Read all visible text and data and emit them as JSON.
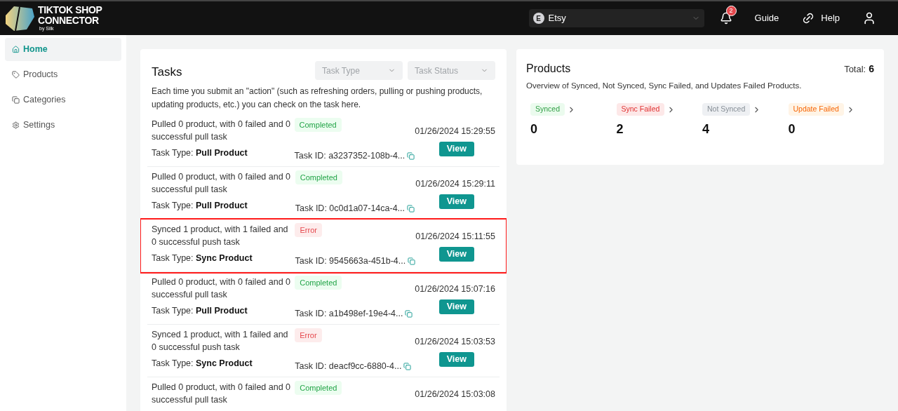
{
  "logo": {
    "line1": "TIKTOK SHOP",
    "line2": "CONNECTOR",
    "byline": "by Silk"
  },
  "header": {
    "store": {
      "initial": "E",
      "name": "Etsy"
    },
    "notifications": "2",
    "guide": "Guide",
    "help": "Help"
  },
  "sidebar": {
    "items": [
      {
        "label": "Home",
        "selected": true
      },
      {
        "label": "Products",
        "selected": false
      },
      {
        "label": "Categories",
        "selected": false
      },
      {
        "label": "Settings",
        "selected": false
      }
    ]
  },
  "tasks": {
    "title": "Tasks",
    "filters": [
      {
        "placeholder": "Task Type"
      },
      {
        "placeholder": "Task Status"
      }
    ],
    "description": "Each time you submit an \"action\" (such as refreshing orders, pulling or pushing products, updating products, etc.) you can check on the task here.",
    "rows": [
      {
        "summary": "Pulled 0 product, with 0 failed and 0 successful pull task",
        "status": "Completed",
        "kind": "completed",
        "type_label": "Task Type:",
        "type": "Pull Product",
        "task_id": "Task ID: a3237352-108b-4...",
        "date": "01/26/2024 15:29:55",
        "view": "View",
        "highlighted": false
      },
      {
        "summary": "Pulled 0 product, with 0 failed and 0 successful pull task",
        "status": "Completed",
        "kind": "completed",
        "type_label": "Task Type:",
        "type": "Pull Product",
        "task_id": "Task ID: 0c0d1a07-14ca-4...",
        "date": "01/26/2024 15:29:11",
        "view": "View",
        "highlighted": false
      },
      {
        "summary": "Synced 1 product, with 1 failed and 0 successful push task",
        "status": "Error",
        "kind": "error",
        "type_label": "Task Type:",
        "type": "Sync Product",
        "task_id": "Task ID: 9545663a-451b-4...",
        "date": "01/26/2024 15:11:55",
        "view": "View",
        "highlighted": true
      },
      {
        "summary": "Pulled 0 product, with 0 failed and 0 successful pull task",
        "status": "Completed",
        "kind": "completed",
        "type_label": "Task Type:",
        "type": "Pull Product",
        "task_id": "Task ID: a1b498ef-19e4-4...",
        "date": "01/26/2024 15:07:16",
        "view": "View",
        "highlighted": false
      },
      {
        "summary": "Synced 1 product, with 1 failed and 0 successful push task",
        "status": "Error",
        "kind": "error",
        "type_label": "Task Type:",
        "type": "Sync Product",
        "task_id": "Task ID: deacf9cc-6880-4...",
        "date": "01/26/2024 15:03:53",
        "view": "View",
        "highlighted": false
      },
      {
        "summary": "Pulled 0 product, with 0 failed and 0 successful pull task",
        "status": "Completed",
        "kind": "completed",
        "date": "01/26/2024 15:03:08",
        "highlighted": false
      }
    ]
  },
  "products": {
    "title": "Products",
    "total_label": "Total:",
    "total": "6",
    "description": "Overview of Synced, Not Synced, Sync Failed, and Updates Failed Products.",
    "stats": [
      {
        "label": "Synced",
        "kind": "synced",
        "count": "0"
      },
      {
        "label": "Sync Failed",
        "kind": "failed",
        "count": "2"
      },
      {
        "label": "Not Synced",
        "kind": "not_synced",
        "count": "4"
      },
      {
        "label": "Update Failed",
        "kind": "update_failed",
        "count": "0"
      }
    ]
  }
}
